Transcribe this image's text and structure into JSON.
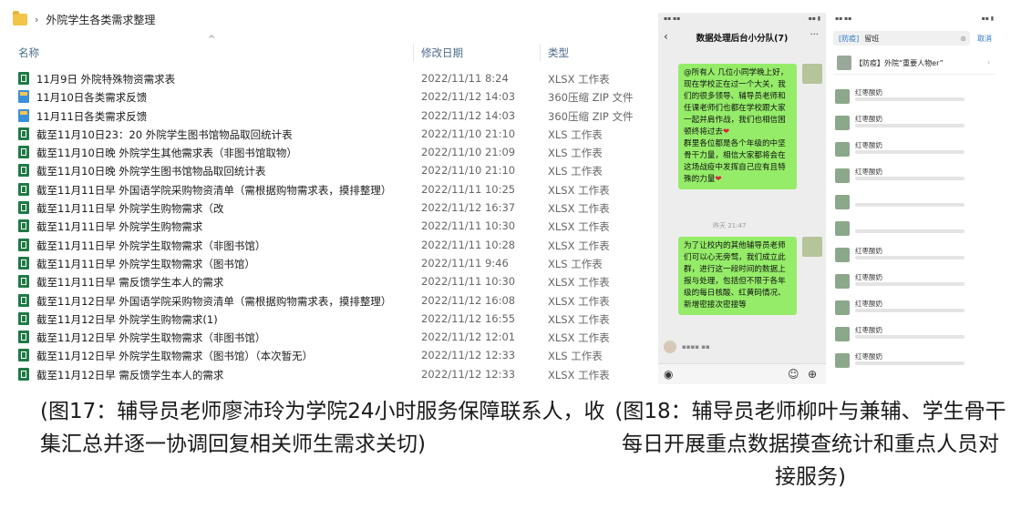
{
  "explorer": {
    "breadcrumb": "外院学生各类需求整理",
    "columns": {
      "name": "名称",
      "date": "修改日期",
      "type": "类型"
    },
    "files": [
      {
        "icon": "xlsx",
        "name": "11月9日 外院特殊物资需求表",
        "date": "2022/11/11 8:24",
        "type": "XLSX 工作表"
      },
      {
        "icon": "zip",
        "name": "11月10日各类需求反馈",
        "date": "2022/11/12 14:03",
        "type": "360压缩 ZIP 文件"
      },
      {
        "icon": "zip",
        "name": "11月11日各类需求反馈",
        "date": "2022/11/12 14:03",
        "type": "360压缩 ZIP 文件"
      },
      {
        "icon": "xlsx",
        "name": "截至11月10日23：20 外院学生图书馆物品取回统计表",
        "date": "2022/11/10 21:10",
        "type": "XLS 工作表"
      },
      {
        "icon": "xlsx",
        "name": "截至11月10日晚 外院学生其他需求表（非图书馆取物）",
        "date": "2022/11/10 21:09",
        "type": "XLS 工作表"
      },
      {
        "icon": "xlsx",
        "name": "截至11月10日晚 外院学生图书馆物品取回统计表",
        "date": "2022/11/10 21:10",
        "type": "XLS 工作表"
      },
      {
        "icon": "xlsx",
        "name": "截至11月11日早 外国语学院采购物资清单（需根据购物需求表，摸排整理）",
        "date": "2022/11/11 10:25",
        "type": "XLSX 工作表"
      },
      {
        "icon": "xlsx",
        "name": "截至11月11日早 外院学生购物需求（改",
        "date": "2022/11/12 16:37",
        "type": "XLSX 工作表"
      },
      {
        "icon": "xlsx",
        "name": "截至11月11日早 外院学生购物需求",
        "date": "2022/11/11 10:30",
        "type": "XLSX 工作表"
      },
      {
        "icon": "xlsx",
        "name": "截至11月11日早 外院学生取物需求（非图书馆）",
        "date": "2022/11/11 10:28",
        "type": "XLSX 工作表"
      },
      {
        "icon": "xlsx",
        "name": "截至11月11日早 外院学生取物需求（图书馆）",
        "date": "2022/11/11 9:46",
        "type": "XLS 工作表"
      },
      {
        "icon": "xlsx",
        "name": "截至11月11日早 需反馈学生本人的需求",
        "date": "2022/11/11 10:30",
        "type": "XLSX 工作表"
      },
      {
        "icon": "xlsx",
        "name": "截至11月12日早 外国语学院采购物资清单（需根据购物需求表，摸排整理）",
        "date": "2022/11/12 16:08",
        "type": "XLSX 工作表"
      },
      {
        "icon": "xlsx",
        "name": "截至11月12日早 外院学生购物需求(1)",
        "date": "2022/11/12 16:55",
        "type": "XLSX 工作表"
      },
      {
        "icon": "xlsx",
        "name": "截至11月12日早 外院学生取物需求（非图书馆）",
        "date": "2022/11/12 12:01",
        "type": "XLSX 工作表"
      },
      {
        "icon": "xlsx",
        "name": "截至11月12日早 外院学生取物需求（图书馆）（本次暂无）",
        "date": "2022/11/12 12:33",
        "type": "XLS 工作表"
      },
      {
        "icon": "xlsx",
        "name": "截至11月12日早 需反馈学生本人的需求",
        "date": "2022/11/12 12:33",
        "type": "XLSX 工作表"
      }
    ]
  },
  "chat": {
    "title": "数据处理后台小分队(7)",
    "message1_a": "@所有人  几位小同学晚上好，现在学校正在过一个大关，我们的很多领导、辅导员老师和任课老师们也都在学校跟大家一起并肩作战，我们也相信困顿终将过去",
    "message1_b": "群里各位都是各个年级的中坚骨干力量，相信大家都将会在这场战疫中发挥自己应有且特殊的力量",
    "timestamp": "昨天 21:47",
    "message2": "为了让校内的其他辅导员老师们可以心无旁骛，我们成立此群，进行这一段时间的数据上报与处理，包括但不限于各年级的每日核酸、红黄码情况、新增密接次密接等"
  },
  "search": {
    "tag": "[防疫]",
    "keyword": "留班",
    "cancel": "取消",
    "group_name": "【防疫】外院“重要人物er”",
    "results": [
      {
        "name": "红枣酸奶"
      },
      {
        "name": "红枣酸奶"
      },
      {
        "name": "红枣酸奶"
      },
      {
        "name": "红枣酸奶"
      },
      {
        "name": ""
      },
      {
        "name": ""
      },
      {
        "name": "红枣酸奶"
      },
      {
        "name": "红枣酸奶"
      },
      {
        "name": "红枣酸奶"
      },
      {
        "name": "红枣酸奶"
      },
      {
        "name": "红枣酸奶"
      }
    ]
  },
  "captions": {
    "left": "(图17：辅导员老师廖沛玲为学院24小时服务保障联系人，收集汇总并逐一协调回复相关师生需求关切)",
    "right": "(图18：辅导员老师柳叶与兼辅、学生骨干每日开展重点数据摸查统计和重点人员对接服务)"
  }
}
